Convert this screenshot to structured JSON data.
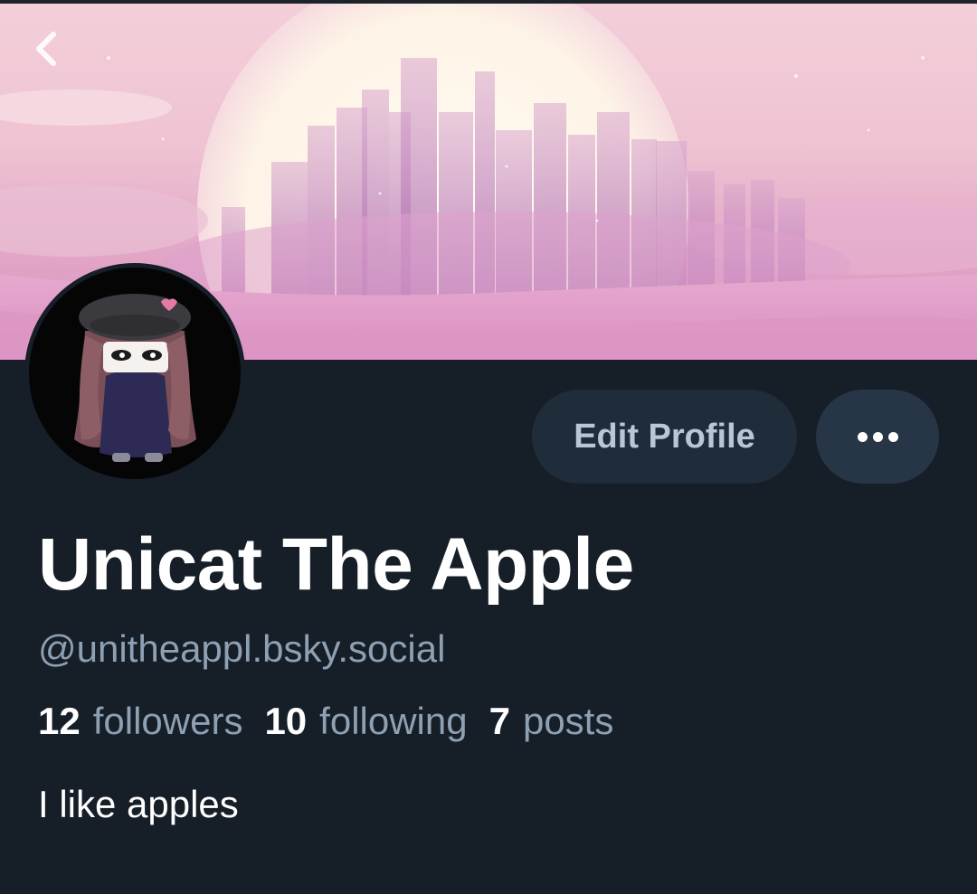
{
  "profile": {
    "display_name": "Unicat The Apple",
    "handle": "@unitheappl.bsky.social",
    "bio": "I like apples",
    "stats": {
      "followers_count": "12",
      "followers_label": "followers",
      "following_count": "10",
      "following_label": "following",
      "posts_count": "7",
      "posts_label": "posts"
    }
  },
  "actions": {
    "edit_profile_label": "Edit Profile",
    "more_icon": "ellipsis-icon",
    "back_icon": "chevron-left-icon"
  },
  "colors": {
    "background": "#161e27",
    "edit_button_bg": "#1f2c3a",
    "more_button_bg": "#263646",
    "secondary_text": "#8ea0b3",
    "primary_text": "#ffffff"
  }
}
